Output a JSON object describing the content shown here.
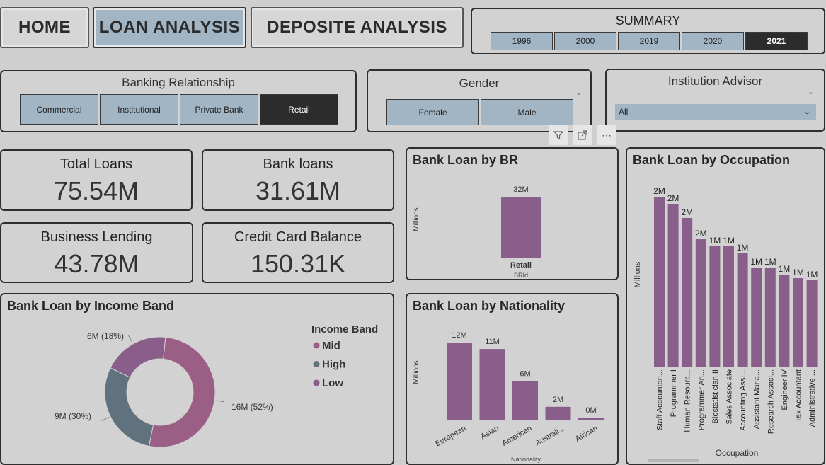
{
  "nav": {
    "home": "HOME",
    "loan": "LOAN ANALYSIS",
    "deposit": "DEPOSITE ANALYSIS"
  },
  "summary": {
    "title": "SUMMARY",
    "years": [
      "1996",
      "2000",
      "2019",
      "2020",
      "2021"
    ],
    "selected_year": "2021"
  },
  "banking_relationship": {
    "title": "Banking Relationship",
    "options": [
      "Commercial",
      "Institutional",
      "Private Bank",
      "Retail"
    ],
    "selected": "Retail"
  },
  "gender": {
    "title": "Gender",
    "options": [
      "Female",
      "Male"
    ]
  },
  "institution_advisor": {
    "title": "Institution Advisor",
    "value": "All"
  },
  "kpis": {
    "total_loans": {
      "label": "Total Loans",
      "value": "75.54M"
    },
    "bank_loans": {
      "label": "Bank loans",
      "value": "31.61M"
    },
    "business_lending": {
      "label": "Business Lending",
      "value": "43.78M"
    },
    "credit_card_balance": {
      "label": "Credit Card Balance",
      "value": "150.31K"
    }
  },
  "colors": {
    "accent_slicer": "#a2b5c4",
    "selected_dark": "#2c2c2c",
    "bar_purple": "#8a5e8a",
    "donut_mid": "#9b5f86",
    "donut_high": "#5f727d",
    "donut_low": "#8a5e8a"
  },
  "chart_data": [
    {
      "id": "br",
      "type": "bar",
      "title": "Bank Loan by BR",
      "xlabel": "BRId",
      "ylabel": "Millions",
      "categories": [
        "Retail"
      ],
      "values": [
        32
      ],
      "data_labels": [
        "32M"
      ],
      "ylim": [
        0,
        32
      ]
    },
    {
      "id": "income",
      "type": "pie",
      "title": "Bank Loan by Income Band",
      "legend_title": "Income Band",
      "legend_position": "right",
      "categories": [
        "Mid",
        "High",
        "Low"
      ],
      "values": [
        16,
        9,
        6
      ],
      "data_labels": [
        "16M (52%)",
        "9M (30%)",
        "6M (18%)"
      ]
    },
    {
      "id": "nationality",
      "type": "bar",
      "title": "Bank Loan by Nationality",
      "xlabel": "Nationality",
      "ylabel": "Millions",
      "categories": [
        "European",
        "Asian",
        "American",
        "Australi...",
        "African"
      ],
      "values": [
        12,
        11,
        6,
        2,
        0.3
      ],
      "data_labels": [
        "12M",
        "11M",
        "6M",
        "2M",
        "0M"
      ],
      "ylim": [
        0,
        12
      ]
    },
    {
      "id": "occupation",
      "type": "bar",
      "title": "Bank Loan by Occupation",
      "xlabel": "Occupation",
      "ylabel": "Millions",
      "categories": [
        "Staff Accountan...",
        "Programmer I",
        "Human Resourc...",
        "Programmer An...",
        "Biostatistician II",
        "Sales Associate",
        "Accounting Assi...",
        "Assistant Mana...",
        "Research Associ...",
        "Engineer IV",
        "Tax Accountant",
        "Administrative ..."
      ],
      "values": [
        2.4,
        2.3,
        2.1,
        1.8,
        1.7,
        1.7,
        1.6,
        1.4,
        1.4,
        1.3,
        1.25,
        1.22
      ],
      "data_labels": [
        "2M",
        "2M",
        "2M",
        "2M",
        "1M",
        "1M",
        "1M",
        "1M",
        "1M",
        "1M",
        "1M",
        "1M"
      ],
      "ylim": [
        0,
        2.4
      ]
    }
  ]
}
